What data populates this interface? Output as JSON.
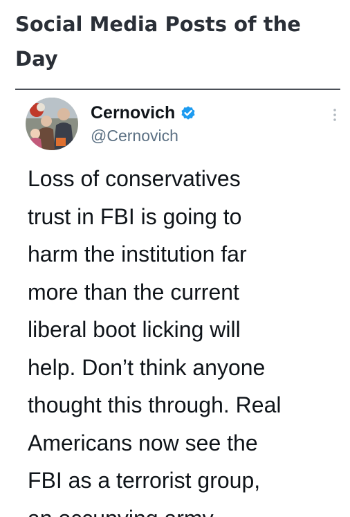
{
  "article": {
    "headline": "Social Media Posts of the Day"
  },
  "tweet": {
    "display_name": "Cernovich",
    "handle": "@Cernovich",
    "verified": true,
    "avatar_icon": "profile-photo",
    "more_icon": "more-options-icon",
    "text": "Loss of conservatives\ntrust in FBI is going to\nharm the institution far\nmore than the current\nliberal boot licking will\nhelp. Don’t think anyone\nthought this through. Real\nAmericans now see the\nFBI as a terrorist group,\nan occupying army."
  },
  "colors": {
    "headline": "#2a2f37",
    "body_text": "#0f1419",
    "handle": "#5b7083",
    "verified_badge": "#1d9bf0"
  }
}
